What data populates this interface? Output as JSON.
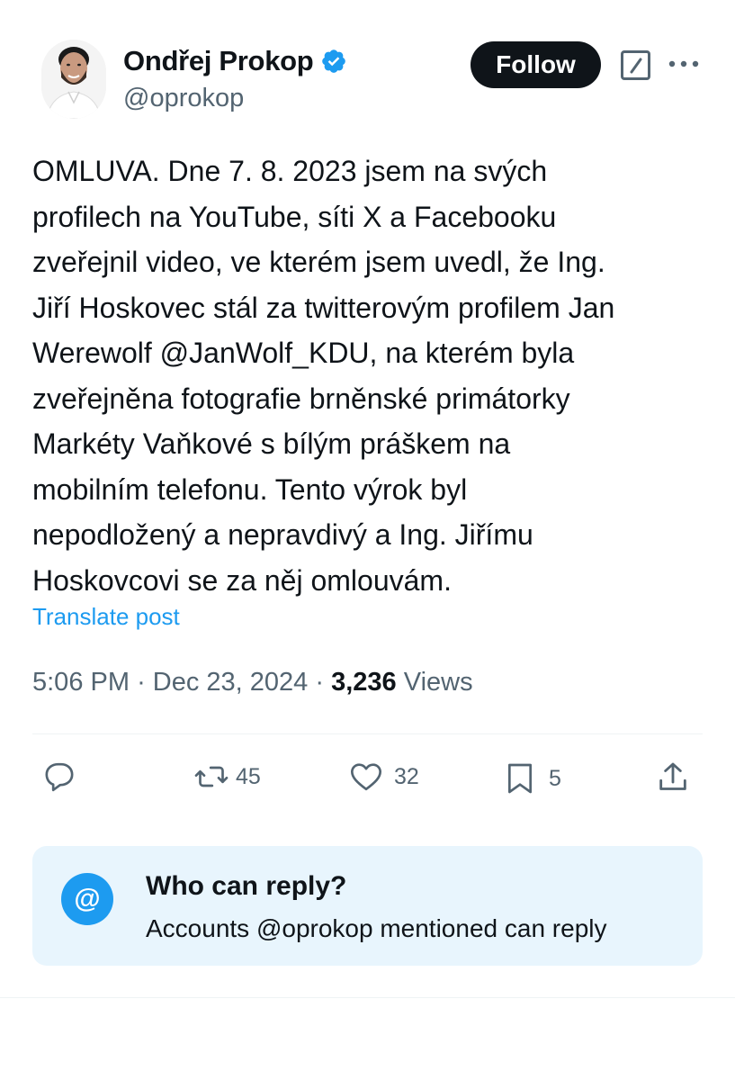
{
  "author": {
    "name": "Ondřej Prokop",
    "handle": "@oprokop",
    "verified": true,
    "avatar_icon": "profile-photo"
  },
  "header": {
    "follow_label": "Follow",
    "grok_icon": "grok-icon",
    "more_icon": "more-icon"
  },
  "post": {
    "text": "OMLUVA. Dne 7. 8. 2023 jsem na svých\nprofilech na YouTube, síti X a Facebooku\nzveřejnil video, ve kterém jsem uvedl, že Ing.\nJiří Hoskovec stál za twitterovým profilem Jan\nWerewolf @JanWolf_KDU, na kterém byla\nzveřejněna fotografie brněnské primátorky\nMarkéty Vaňkové s bílým práškem na\nmobilním telefonu. Tento výrok byl\nnepodložený a nepravdivý a Ing. Jiřímu\nHoskovcovi se za něj omlouvám.",
    "translate_label": "Translate post",
    "time": "5:06 PM",
    "date": "Dec 23, 2024",
    "separator": "·",
    "views_count": "3,236",
    "views_label": "Views"
  },
  "actions": {
    "reply_count": "",
    "repost_count": "45",
    "like_count": "32",
    "bookmark_count": "5"
  },
  "who_can_reply": {
    "icon": "@",
    "title": "Who can reply?",
    "description": "Accounts @oprokop mentioned can reply"
  },
  "colors": {
    "accent": "#1d9bf0",
    "text": "#0f1419",
    "secondary": "#536471",
    "reply_box_bg": "#e8f5fd"
  }
}
